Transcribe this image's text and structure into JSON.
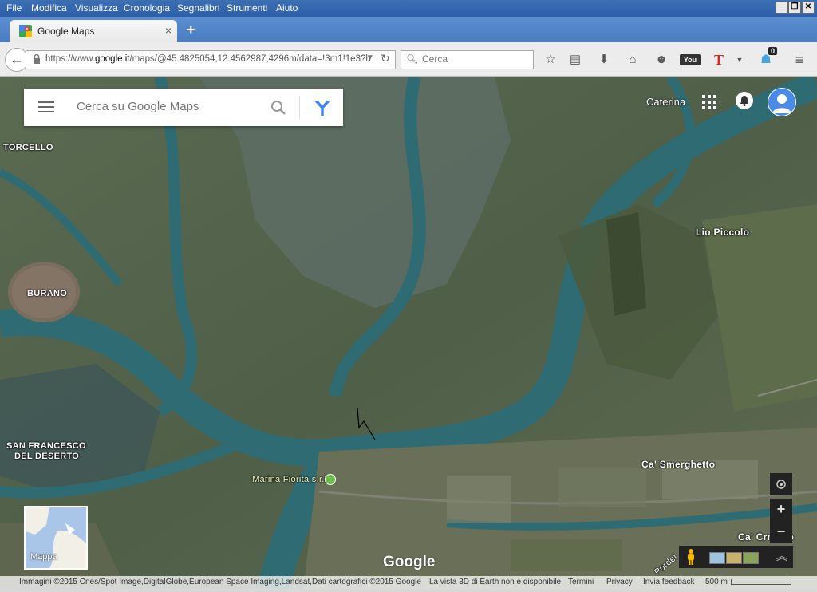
{
  "menubar": {
    "items": [
      "File",
      "Modifica",
      "Visualizza",
      "Cronologia",
      "Segnalibri",
      "Strumenti",
      "Aiuto"
    ]
  },
  "tab": {
    "title": "Google Maps",
    "close": "×",
    "new": "+"
  },
  "navbar": {
    "url_prefix": "https://www.",
    "url_domain": "google.it",
    "url_rest": "/maps/@45.4825054,12.4562987,4296m/data=!3m1!1e3?h",
    "search_placeholder": "Cerca",
    "badge": "0"
  },
  "map": {
    "search_placeholder": "Cerca su Google Maps",
    "user_name": "Caterina",
    "minimap_label": "Mappa",
    "logo": "Google",
    "labels": {
      "torcello": "TORCELLO",
      "burano": "BURANO",
      "san_francesco": "SAN FRANCESCO",
      "del_deserto": "DEL DESERTO",
      "lio_piccolo": "Lio Piccolo",
      "marina_fiorita": "Marina Fiorita s.r.l",
      "ca_smerghetto": "Ca' Smerghetto",
      "ca_crnaldo": "Ca' Crnaldo",
      "pordel": "Pordel"
    },
    "footer": {
      "attribution": "Immagini ©2015 Cnes/Spot Image,DigitalGlobe,European Space Imaging,Landsat,Dati cartografici ©2015 Google",
      "earth": "La vista 3D di Earth non è disponibile",
      "terms": "Termini",
      "privacy": "Privacy",
      "feedback": "Invia feedback",
      "scale": "500 m"
    },
    "controls": {
      "zoom_in": "+",
      "zoom_out": "−"
    }
  }
}
